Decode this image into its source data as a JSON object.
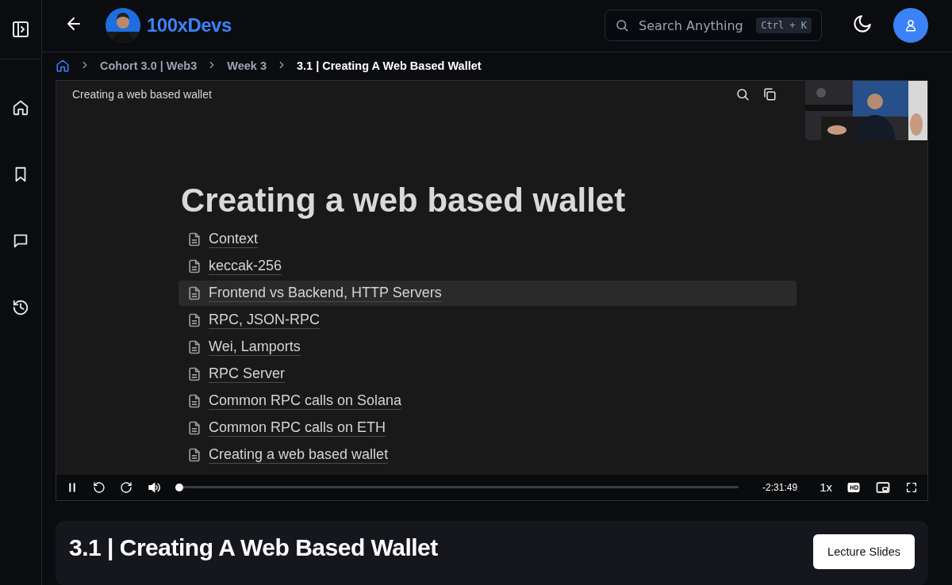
{
  "header": {
    "brand": "100xDevs",
    "search": {
      "placeholder": "Search Anything",
      "shortcut": "Ctrl + K"
    }
  },
  "breadcrumbs": [
    {
      "label": "Cohort 3.0 | Web3",
      "current": false
    },
    {
      "label": "Week 3",
      "current": false
    },
    {
      "label": "3.1 | Creating A Web Based Wallet",
      "current": true
    }
  ],
  "video": {
    "page_title": "Creating a web based wallet",
    "heading": "Creating a web based wallet",
    "pages": [
      {
        "label": "Context",
        "highlighted": false
      },
      {
        "label": "keccak-256",
        "highlighted": false
      },
      {
        "label": "Frontend vs Backend, HTTP Servers",
        "highlighted": true
      },
      {
        "label": "RPC, JSON-RPC",
        "highlighted": false
      },
      {
        "label": "Wei, Lamports",
        "highlighted": false
      },
      {
        "label": "RPC Server",
        "highlighted": false
      },
      {
        "label": "Common RPC calls on Solana",
        "highlighted": false
      },
      {
        "label": "Common RPC calls on ETH",
        "highlighted": false
      },
      {
        "label": "Creating a web based wallet",
        "highlighted": false
      }
    ],
    "controls": {
      "playing": true,
      "time": "-2:31:49",
      "speed": "1x"
    }
  },
  "lecture": {
    "title": "3.1 | Creating A Web Based Wallet",
    "button": "Lecture Slides"
  }
}
